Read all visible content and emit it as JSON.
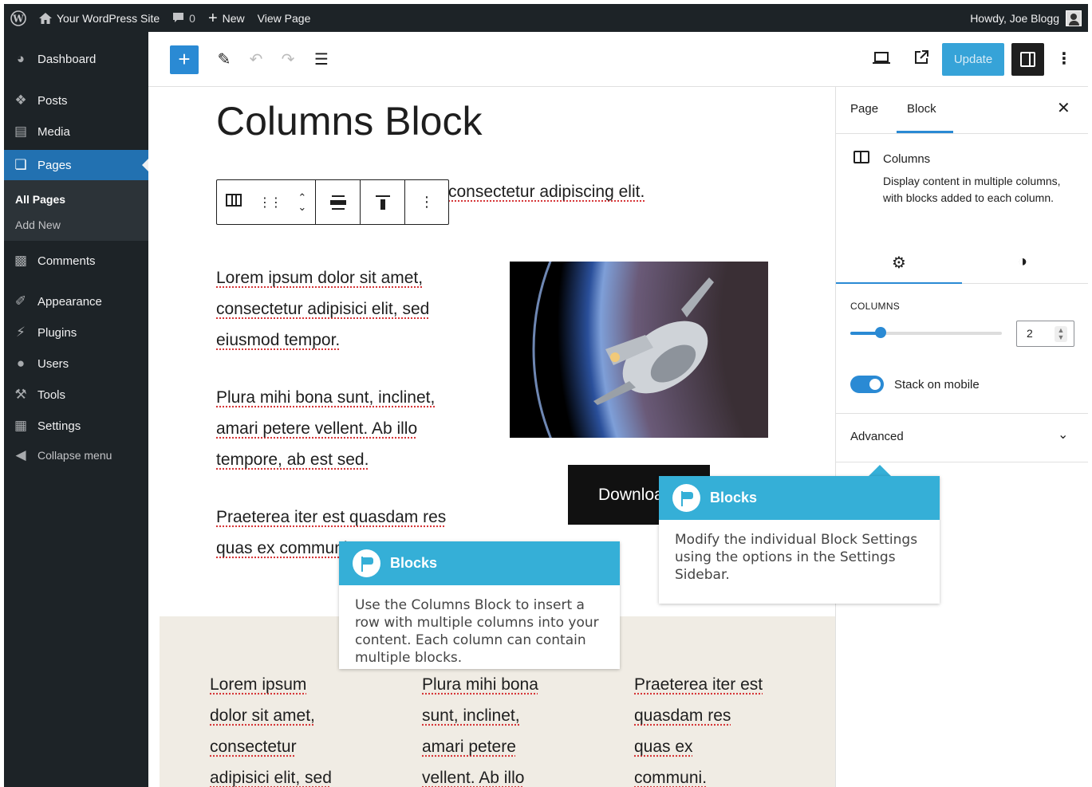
{
  "admin_bar": {
    "site_name": "Your WordPress Site",
    "comments_count": "0",
    "new_label": "New",
    "view_label": "View Page",
    "howdy": "Howdy, Joe Blogg"
  },
  "sidebar": {
    "items": [
      {
        "label": "Dashboard",
        "icon": "dashboard-icon"
      },
      {
        "label": "Posts",
        "icon": "pin-icon"
      },
      {
        "label": "Media",
        "icon": "media-icon"
      },
      {
        "label": "Pages",
        "icon": "pages-icon"
      },
      {
        "label": "Comments",
        "icon": "comment-icon"
      },
      {
        "label": "Appearance",
        "icon": "brush-icon"
      },
      {
        "label": "Plugins",
        "icon": "plug-icon"
      },
      {
        "label": "Users",
        "icon": "user-icon"
      },
      {
        "label": "Tools",
        "icon": "wrench-icon"
      },
      {
        "label": "Settings",
        "icon": "settings-icon"
      },
      {
        "label": "Collapse menu",
        "icon": "collapse-icon"
      }
    ],
    "submenu": [
      "All Pages",
      "Add New"
    ],
    "accent_color": "#2271b1"
  },
  "editor_header": {
    "update_label": "Update",
    "accent_color": "#2a8ad4"
  },
  "content": {
    "title": "Columns Block",
    "intro_fragment": "consectetur adipiscing elit.",
    "left_paragraphs": [
      [
        "Lorem ipsum dolor sit amet,",
        "consectetur adipisici elit, sed",
        "eiusmod tempor."
      ],
      [
        "Plura mihi bona sunt, inclinet,",
        "amari petere vellent. Ab illo",
        "tempore, ab est sed."
      ],
      [
        "Praeterea iter est quasdam res",
        "quas ex communi."
      ]
    ],
    "button_label": "Download",
    "columns": [
      [
        "Lorem ipsum",
        "dolor sit amet,",
        "consectetur",
        "adipisici elit, sed"
      ],
      [
        "Plura mihi bona",
        "sunt, inclinet,",
        "amari petere",
        "vellent. Ab illo"
      ],
      [
        "Praeterea iter est",
        "quasdam res",
        "quas ex",
        "communi."
      ]
    ]
  },
  "settings_panel": {
    "tab_page": "Page",
    "tab_block": "Block",
    "block_name": "Columns",
    "block_description": "Display content in multiple columns, with blocks added to each column.",
    "columns_label": "Columns",
    "columns_value": "2",
    "columns_slider_fraction": 0.2,
    "stack_label": "Stack on mobile",
    "stack_on": true,
    "advanced_label": "Advanced"
  },
  "tooltips": [
    {
      "title": "Blocks",
      "body": "Use the Columns Block to insert a row with multiple columns into your content. Each column can contain multiple blocks."
    },
    {
      "title": "Blocks",
      "body": "Modify the individual Block Settings using the options in the Settings Sidebar."
    }
  ],
  "tooltip_color": "#35afd7"
}
